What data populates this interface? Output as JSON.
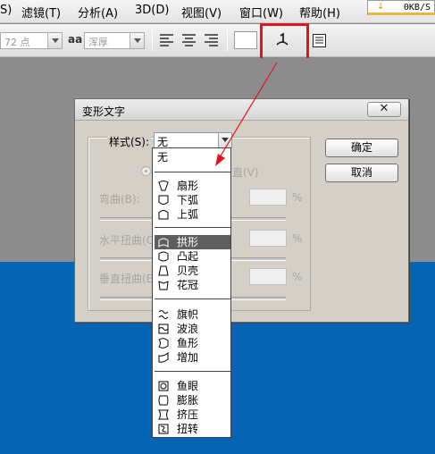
{
  "menubar": {
    "items": [
      "S)",
      "滤镜(T)",
      "分析(A)",
      "3D(D)",
      "视图(V)",
      "窗口(W)",
      "帮助(H)"
    ]
  },
  "speed_indicator": {
    "text": "0KB/S",
    "arrow": "↓"
  },
  "options_bar": {
    "font_size": "72 点",
    "aa_label": "aa",
    "antialias": "浑厚",
    "align_left_icon": "align-left-icon",
    "align_center_icon": "align-center-icon",
    "align_right_icon": "align-right-icon",
    "warp_icon": "warp-text-icon",
    "panel_icon": "character-panel-icon"
  },
  "dialog": {
    "title": "变形文字",
    "close": "✕",
    "style_label": "样式(S):",
    "style_value": "无",
    "orientation_suffix": "直(V)",
    "bend_label": "弯曲(B):",
    "h_distort_label": "水平扭曲(O",
    "v_distort_label": "垂直扭曲(E",
    "percent": "%",
    "ok_button": "确定",
    "cancel_button": "取消"
  },
  "dropdown": {
    "none": "无",
    "groups": [
      [
        {
          "label": "扇形",
          "icon": "arc-icon"
        },
        {
          "label": "下弧",
          "icon": "arc-lower-icon"
        },
        {
          "label": "上弧",
          "icon": "arc-upper-icon"
        }
      ],
      [
        {
          "label": "拱形",
          "icon": "arch-icon"
        },
        {
          "label": "凸起",
          "icon": "bulge-icon"
        },
        {
          "label": "贝壳",
          "icon": "shell-icon"
        },
        {
          "label": "花冠",
          "icon": "flag-crown-icon"
        }
      ],
      [
        {
          "label": "旗帜",
          "icon": "flag-icon"
        },
        {
          "label": "波浪",
          "icon": "wave-icon"
        },
        {
          "label": "鱼形",
          "icon": "fish-icon"
        },
        {
          "label": "增加",
          "icon": "rise-icon"
        }
      ],
      [
        {
          "label": "鱼眼",
          "icon": "fisheye-icon"
        },
        {
          "label": "膨胀",
          "icon": "inflate-icon"
        },
        {
          "label": "挤压",
          "icon": "squeeze-icon"
        },
        {
          "label": "扭转",
          "icon": "twist-icon"
        }
      ]
    ],
    "selected": "拱形"
  },
  "colors": {
    "highlight": "#e0141b",
    "workspace_blue": "#0564b4",
    "selection": "#5e5e5e"
  }
}
